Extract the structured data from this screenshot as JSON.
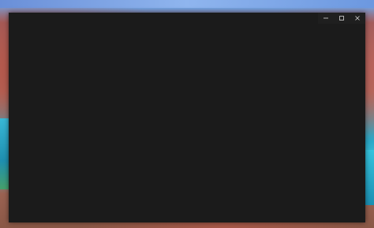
{
  "desktop": {
    "wallpaper": "canyon-river-landscape",
    "colors": {
      "sky": "#6fa6e8",
      "rock": "#b06a5c",
      "water": "#2aa8c8"
    }
  },
  "window": {
    "background": "#1b1b1b",
    "controls": [
      {
        "name": "minimize",
        "icon": "minimize-icon"
      },
      {
        "name": "maximize",
        "icon": "maximize-icon"
      },
      {
        "name": "close",
        "icon": "close-icon"
      }
    ]
  }
}
